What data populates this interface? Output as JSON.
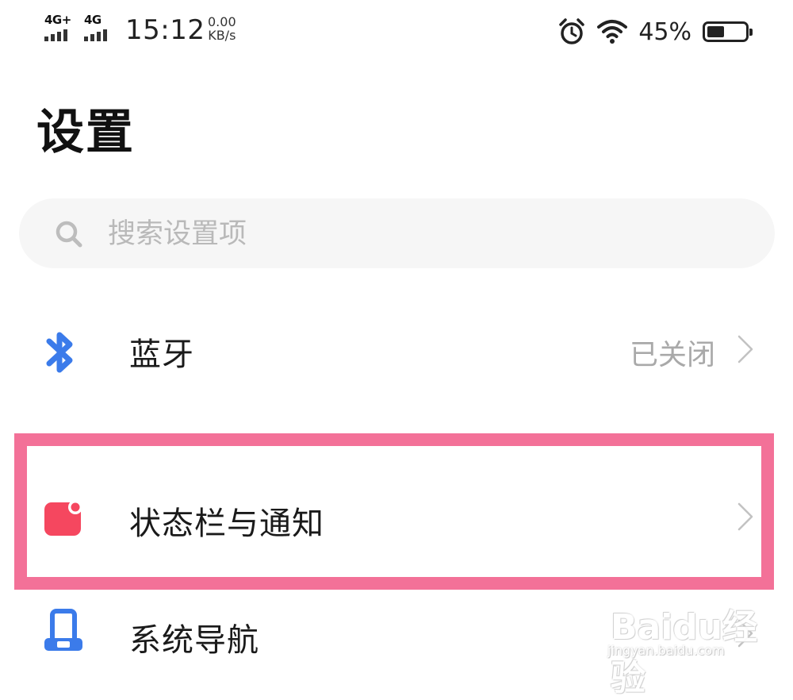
{
  "status_bar": {
    "sim1_network": "4G+",
    "sim2_network": "4G",
    "time": "15:12",
    "speed_value": "0.00",
    "speed_unit": "KB/s",
    "battery_percent": "45%",
    "battery_level": 0.45,
    "icons": [
      "signal-icon",
      "alarm-icon",
      "wifi-icon",
      "battery-icon"
    ]
  },
  "header": {
    "title": "设置"
  },
  "search": {
    "placeholder": "搜索设置项",
    "value": ""
  },
  "settings": {
    "items": [
      {
        "label": "蓝牙",
        "value": "已关闭",
        "icon": "bluetooth-icon",
        "icon_color": "#3b7bea"
      },
      {
        "label": "状态栏与通知",
        "value": "",
        "icon": "notification-icon",
        "icon_color": "#f5475f",
        "highlighted": true
      },
      {
        "label": "系统导航",
        "value": "",
        "icon": "navigation-icon",
        "icon_color": "#3b7bea"
      }
    ]
  },
  "watermark": {
    "brand": "Baidu经验",
    "url": "jingyan.baidu.com"
  },
  "colors": {
    "highlight": "#f37198",
    "accent_blue": "#3b7bea",
    "accent_red": "#f5475f"
  }
}
